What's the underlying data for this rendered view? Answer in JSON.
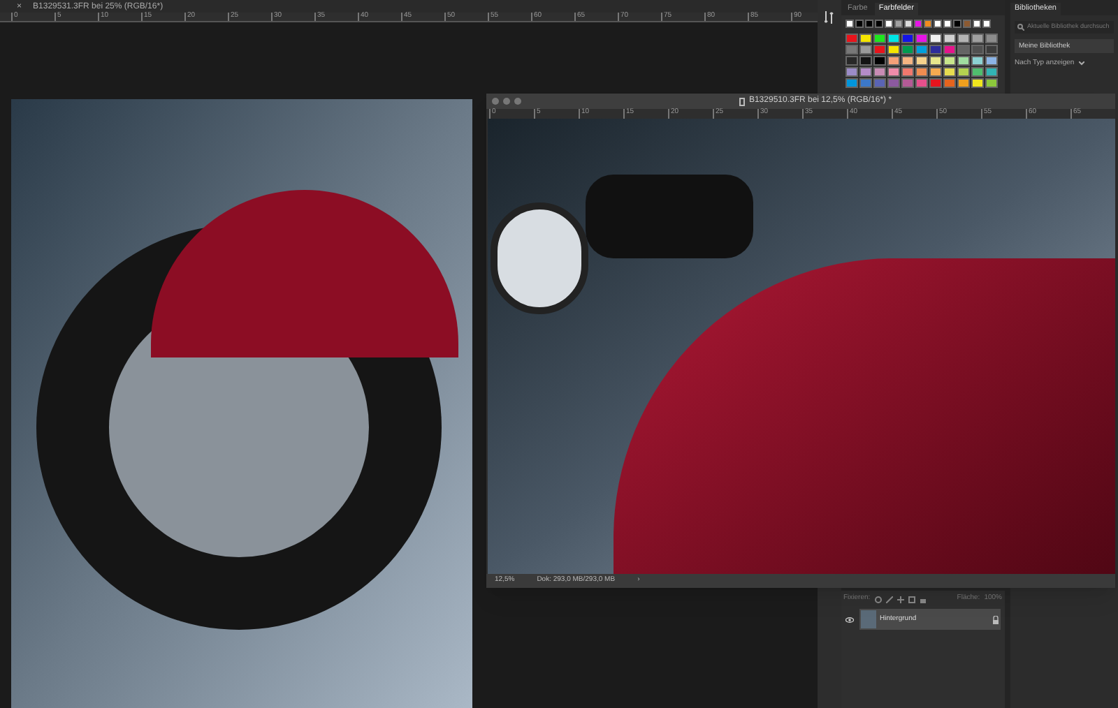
{
  "document_tab": {
    "close": "×",
    "title": "B1329531.3FR bei 25% (RGB/16*)"
  },
  "top_ruler": [
    "0",
    "5",
    "10",
    "15",
    "20",
    "25",
    "30",
    "35",
    "40",
    "45",
    "50",
    "55",
    "60",
    "65",
    "70",
    "75",
    "80",
    "85",
    "90"
  ],
  "floating_window": {
    "title": "B1329510.3FR bei 12,5% (RGB/16*) *",
    "ruler": [
      "0",
      "5",
      "10",
      "15",
      "20",
      "25",
      "30",
      "35",
      "40",
      "45",
      "50",
      "55",
      "60",
      "65"
    ],
    "zoom": "12,5%",
    "doc_size": "Dok: 293,0 MB/293,0 MB",
    "arrow": "›"
  },
  "swatches_panel": {
    "tabs": [
      {
        "label": "Farbe",
        "selected": false
      },
      {
        "label": "Farbfelder",
        "selected": true
      }
    ],
    "recent": [
      {
        "color": "#ffffff"
      },
      {
        "color": "#000000"
      },
      {
        "color": "#000000"
      },
      {
        "color": "#000000"
      },
      {
        "color": "#ffffff"
      },
      {
        "color": "#a0a0a0"
      },
      {
        "color": "#dcdcdc"
      },
      {
        "color": "#e614e6"
      },
      {
        "color": "#f08c1e"
      },
      {
        "color": "#ffffff"
      },
      {
        "color": "#ffffff"
      },
      {
        "color": "#000000"
      },
      {
        "color": "#8c5a32"
      },
      {
        "color": "#ffffff"
      },
      {
        "color": "#ffffff"
      }
    ],
    "grid": [
      {
        "color": "#e8141c"
      },
      {
        "color": "#f5e500"
      },
      {
        "color": "#1ee61e"
      },
      {
        "color": "#00e6e6"
      },
      {
        "color": "#1414e6"
      },
      {
        "color": "#e614e6"
      },
      {
        "color": "#f0f0f0"
      },
      {
        "color": "#d0d0d0"
      },
      {
        "color": "#b4b4b4"
      },
      {
        "color": "#a0a0a0"
      },
      {
        "color": "#8c8c8c"
      },
      {
        "color": "#787878"
      },
      {
        "color": "#9b9b9b"
      },
      {
        "color": "#e8141c"
      },
      {
        "color": "#f5e500"
      },
      {
        "color": "#009b50"
      },
      {
        "color": "#00a0dc"
      },
      {
        "color": "#2d2d9b"
      },
      {
        "color": "#e6148c"
      },
      {
        "color": "#646464"
      },
      {
        "color": "#505050"
      },
      {
        "color": "#3c3c3c"
      },
      {
        "color": "#282828"
      },
      {
        "color": "#141414"
      },
      {
        "color": "#000000"
      },
      {
        "color": "#f5a078"
      },
      {
        "color": "#f5b482"
      },
      {
        "color": "#f5d28c"
      },
      {
        "color": "#e6e68c"
      },
      {
        "color": "#c8e68c"
      },
      {
        "color": "#a0dca0"
      },
      {
        "color": "#8cd2d2"
      },
      {
        "color": "#8cb4e6"
      },
      {
        "color": "#9b8cc8"
      },
      {
        "color": "#b48cc8"
      },
      {
        "color": "#c88cb4"
      },
      {
        "color": "#f08caa"
      },
      {
        "color": "#f0786e"
      },
      {
        "color": "#f08c50"
      },
      {
        "color": "#f5aa50"
      },
      {
        "color": "#e6dc50"
      },
      {
        "color": "#b4d250"
      },
      {
        "color": "#50be6e"
      },
      {
        "color": "#32b4b4"
      },
      {
        "color": "#0096dc"
      },
      {
        "color": "#3c78c8"
      },
      {
        "color": "#5a64b4"
      },
      {
        "color": "#8c5aa0"
      },
      {
        "color": "#b45a96"
      },
      {
        "color": "#e6508c"
      },
      {
        "color": "#e6141e"
      },
      {
        "color": "#e6641e"
      },
      {
        "color": "#f0a01e"
      },
      {
        "color": "#f0e61e"
      },
      {
        "color": "#8cc83c"
      }
    ]
  },
  "libraries_panel": {
    "title": "Bibliotheken",
    "search": {
      "placeholder": "Aktuelle Bibliothek durchsuch"
    },
    "library": "Meine Bibliothek",
    "view": "Nach Typ anzeigen"
  },
  "layers_panel": {
    "lock_label": "Fixieren:",
    "fill_label": "Fläche:",
    "fill_value": "100%",
    "layers": [
      {
        "name": "Hintergrund",
        "visible": true,
        "locked": true,
        "selected": true
      }
    ]
  }
}
